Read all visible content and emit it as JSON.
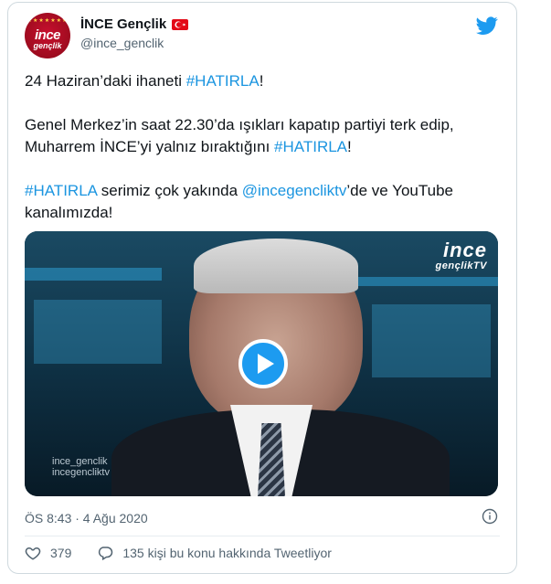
{
  "author": {
    "display_name": "İNCE Gençlik",
    "handle": "@ince_genclik",
    "avatar_text_line1": "ince",
    "avatar_text_line2": "gençlik"
  },
  "tweet": {
    "p1": {
      "before": "24 Haziran’daki ihaneti ",
      "tag": "#HATIRLA",
      "after": "!"
    },
    "p2": {
      "text": "Genel Merkez’in saat 22.30’da ışıkları kapatıp partiyi terk edip, Muharrem İNCE’yi yalnız bıraktığını ",
      "tag": "#HATIRLA",
      "after": "!"
    },
    "p3": {
      "tag": "#HATIRLA",
      "mid": " serimiz çok yakında ",
      "mention": "@incegencliktv",
      "after": "’de ve YouTube kanalımızda!"
    }
  },
  "media": {
    "watermark_top_line1": "ince",
    "watermark_top_line2": "gençlikTV",
    "watermark_bottom_line1": "ince_genclik",
    "watermark_bottom_line2": "incegencliktv"
  },
  "meta": {
    "timestamp": "ÖS 8:43 · 4 Ağu 2020"
  },
  "actions": {
    "likes": "379",
    "discussion": "135 kişi bu konu hakkında Tweetliyor"
  },
  "colors": {
    "accent": "#1d9bf0",
    "link": "#1b95e0",
    "brand_red": "#c8102e"
  },
  "icons": [
    "twitter-icon",
    "turkey-flag-icon",
    "play-icon",
    "info-icon",
    "heart-icon",
    "reply-icon"
  ]
}
